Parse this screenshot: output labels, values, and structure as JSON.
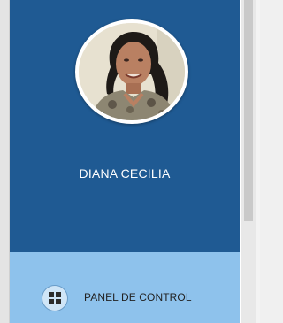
{
  "profile": {
    "name": "DIANA CECILIA",
    "avatar_icon": "user-photo"
  },
  "menu": {
    "items": [
      {
        "label": "PANEL DE CONTROL",
        "icon": "dashboard-grid-icon"
      }
    ]
  },
  "colors": {
    "sidebar_bg": "#1f5a93",
    "menu_bg": "#8ec2ec",
    "name_text": "#ffffff",
    "menu_text": "#222222"
  }
}
